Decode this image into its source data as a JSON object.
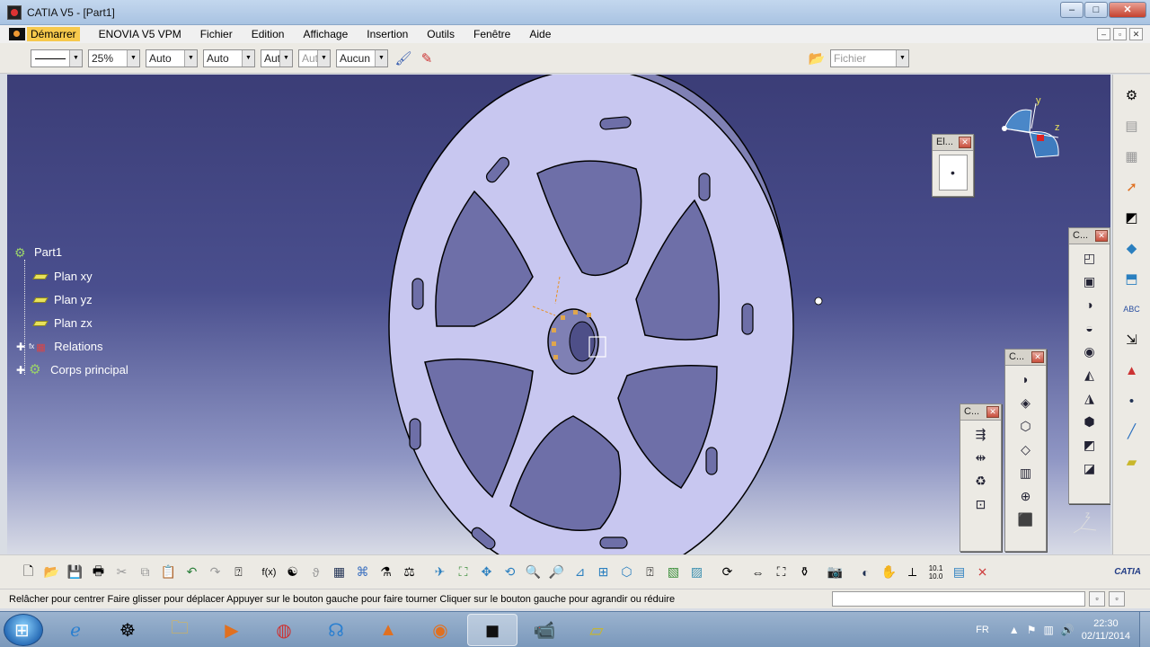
{
  "window": {
    "title": "CATIA V5 - [Part1]",
    "minimize": "–",
    "maximize": "□",
    "close": "✕"
  },
  "menubar": {
    "items": [
      "Démarrer",
      "ENOVIA V5 VPM",
      "Fichier",
      "Edition",
      "Affichage",
      "Insertion",
      "Outils",
      "Fenêtre",
      "Aide"
    ],
    "mdi": [
      "–",
      "▫",
      "✕"
    ]
  },
  "format_toolbar": {
    "line_style": "",
    "zoom": "25%",
    "combo1": "Auto",
    "combo2": "Auto",
    "combo3": "Aut",
    "combo4": "Aut",
    "layer": "Aucun",
    "file_filter": "Fichier"
  },
  "tree": {
    "root": "Part1",
    "items": [
      "Plan xy",
      "Plan yz",
      "Plan zx",
      "Relations",
      "Corps principal"
    ],
    "relations_prefix": "fx"
  },
  "compass": {
    "axis_y": "y",
    "axis_z": "z"
  },
  "floating_toolbars": {
    "el": {
      "title": "El..."
    },
    "c1": {
      "title": "C..."
    },
    "c2": {
      "title": "C..."
    },
    "c3": {
      "title": "C..."
    }
  },
  "right_toolbar": {
    "abc_label": "ABC"
  },
  "bottom_toolbar": {
    "fx_label": "f(x)",
    "coord_label": "10.1 10.0"
  },
  "axis_indicator": {
    "label": "z"
  },
  "statusbar": {
    "message": "Relâcher pour centrer  Faire glisser pour déplacer  Appuyer sur le bouton gauche pour faire tourner  Cliquer sur le bouton gauche pour agrandir ou réduire"
  },
  "taskbar": {
    "lang": "FR",
    "time": "22:30",
    "date": "02/11/2014"
  },
  "catia_logo": "CATIA",
  "colors": {
    "part_face": "#c8c7f0",
    "part_side": "#7f80b4",
    "viewport_top": "#3b3d77",
    "title_bar": "#b0c8e6",
    "highlight": "#f7c94c"
  }
}
